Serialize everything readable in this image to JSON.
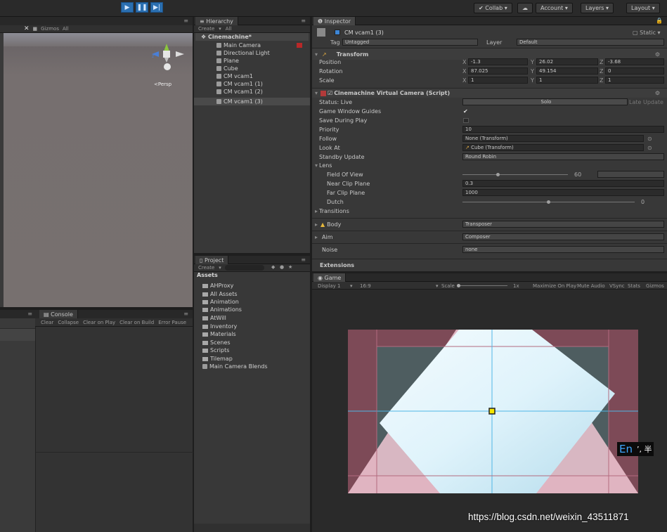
{
  "toolbar": {
    "collab": "Collab",
    "account": "Account",
    "layers": "Layers",
    "layout": "Layout"
  },
  "scene": {
    "toolbar": "Gizmos",
    "toolbar_all": "All",
    "persp": "Persp"
  },
  "hierarchy": {
    "tab": "Hierarchy",
    "create": "Create",
    "all": "All",
    "scene": "Cinemachine*",
    "items": [
      "Main Camera",
      "Directional Light",
      "Plane",
      "Cube",
      "CM vcam1",
      "CM vcam1 (1)",
      "CM vcam1 (2)",
      "CM vcam1 (3)"
    ]
  },
  "project": {
    "tab": "Project",
    "create": "Create",
    "assets": "Assets",
    "items": [
      "AHProxy",
      "All Assets",
      "Animation",
      "Animations",
      "AtWill",
      "Inventory",
      "Materials",
      "Scenes",
      "Scripts",
      "Tilemap",
      "Main Camera Blends"
    ]
  },
  "console": {
    "tab": "Console",
    "buttons": [
      "Clear",
      "Collapse",
      "Clear on Play",
      "Clear on Build",
      "Error Pause"
    ]
  },
  "inspector": {
    "tab": "Inspector",
    "name": "CM vcam1 (3)",
    "static": "Static",
    "tag_label": "Tag",
    "tag": "Untagged",
    "layer_label": "Layer",
    "layer": "Default",
    "transform": {
      "title": "Transform",
      "rows": [
        {
          "label": "Position",
          "x": "-1.3",
          "y": "26.02",
          "z": "-3.68"
        },
        {
          "label": "Rotation",
          "x": "87.025",
          "y": "49.154",
          "z": "0"
        },
        {
          "label": "Scale",
          "x": "1",
          "y": "1",
          "z": "1"
        }
      ]
    },
    "vcam": {
      "title": "Cinemachine Virtual Camera (Script)",
      "status": "Status: Live",
      "solo": "Solo",
      "late_update": "Late Update",
      "window_guides": "Game Window Guides",
      "save_play": "Save During Play",
      "priority_label": "Priority",
      "priority": "10",
      "follow_label": "Follow",
      "follow": "None (Transform)",
      "lookat_label": "Look At",
      "lookat": "Cube (Transform)",
      "standby_label": "Standby Update",
      "standby": "Round Robin",
      "lens": "Lens",
      "fov_label": "Field Of View",
      "fov": "60",
      "near_label": "Near Clip Plane",
      "near": "0.3",
      "far_label": "Far Clip Plane",
      "far": "1000",
      "dutch_label": "Dutch",
      "dutch": "0",
      "transitions": "Transitions",
      "body_label": "Body",
      "body": "Transposer",
      "aim_label": "Aim",
      "aim": "Composer",
      "noise_label": "Noise",
      "noise": "none",
      "extensions": "Extensions"
    }
  },
  "game": {
    "tab": "Game",
    "display": "Display 1",
    "aspect": "16:9",
    "scale": "Scale",
    "scale_val": "1x",
    "maximize": "Maximize On Play",
    "mute": "Mute Audio",
    "vsync": "VSync",
    "stats": "Stats",
    "gizmos": "Gizmos"
  },
  "overlay": {
    "ime": "En",
    "ime_sym": "ʼ, 半",
    "watermark": "https://blog.csdn.net/weixin_43511871"
  },
  "colors": {
    "play_blue": "#2b6fb0",
    "game_bg": "#7d4a57",
    "dead_zone": "#4e5d60",
    "frame": "#d4a3b0",
    "guide": "#4fb6e6",
    "pink": "#f1c7d4",
    "light": "#dff3fb"
  }
}
